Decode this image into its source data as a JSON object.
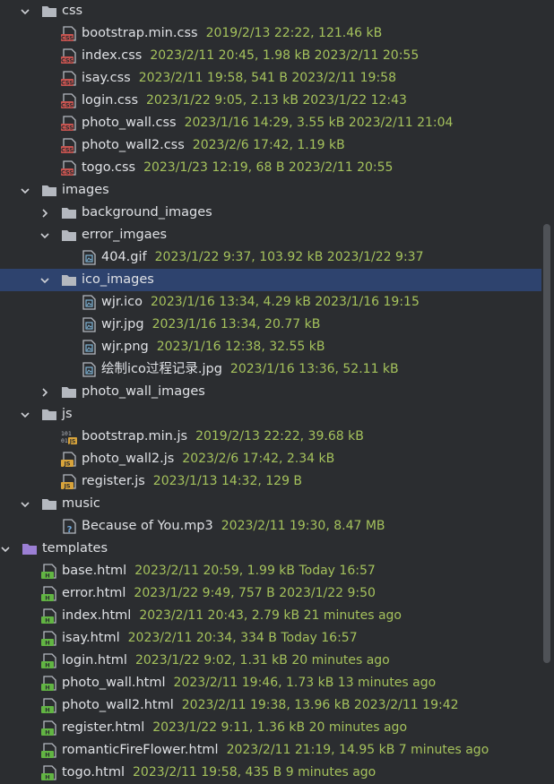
{
  "tree": [
    {
      "depth": 1,
      "kind": "folder",
      "expanded": true,
      "name": "css",
      "meta": ""
    },
    {
      "depth": 2,
      "kind": "css",
      "name": "bootstrap.min.css",
      "meta": "2019/2/13 22:22, 121.46 kB"
    },
    {
      "depth": 2,
      "kind": "css",
      "name": "index.css",
      "meta": "2023/2/11 20:45, 1.98 kB 2023/2/11 20:55"
    },
    {
      "depth": 2,
      "kind": "css",
      "name": "isay.css",
      "meta": "2023/2/11 19:58, 541 B 2023/2/11 19:58"
    },
    {
      "depth": 2,
      "kind": "css",
      "name": "login.css",
      "meta": "2023/1/22 9:05, 2.13 kB 2023/1/22 12:43"
    },
    {
      "depth": 2,
      "kind": "css",
      "name": "photo_wall.css",
      "meta": "2023/1/16 14:29, 3.55 kB 2023/2/11 21:04"
    },
    {
      "depth": 2,
      "kind": "css",
      "name": "photo_wall2.css",
      "meta": "2023/2/6 17:42, 1.19 kB"
    },
    {
      "depth": 2,
      "kind": "css",
      "name": "togo.css",
      "meta": "2023/1/23 12:19, 68 B 2023/2/11 20:55"
    },
    {
      "depth": 1,
      "kind": "folder",
      "expanded": true,
      "name": "images",
      "meta": ""
    },
    {
      "depth": 2,
      "kind": "folder",
      "expanded": false,
      "name": "background_images",
      "meta": ""
    },
    {
      "depth": 2,
      "kind": "folder",
      "expanded": true,
      "name": "error_imgaes",
      "meta": ""
    },
    {
      "depth": 3,
      "kind": "image",
      "name": "404.gif",
      "meta": "2023/1/22 9:37, 103.92 kB 2023/1/22 9:37"
    },
    {
      "depth": 2,
      "kind": "folder",
      "expanded": true,
      "name": "ico_images",
      "meta": "",
      "selected": true
    },
    {
      "depth": 3,
      "kind": "image",
      "name": "wjr.ico",
      "meta": "2023/1/16 13:34, 4.29 kB 2023/1/16 19:15"
    },
    {
      "depth": 3,
      "kind": "image",
      "name": "wjr.jpg",
      "meta": "2023/1/16 13:34, 20.77 kB"
    },
    {
      "depth": 3,
      "kind": "image",
      "name": "wjr.png",
      "meta": "2023/1/16 12:38, 32.55 kB"
    },
    {
      "depth": 3,
      "kind": "image",
      "name": "绘制ico过程记录.jpg",
      "meta": "2023/1/16 13:36, 52.11 kB"
    },
    {
      "depth": 2,
      "kind": "folder",
      "expanded": false,
      "name": "photo_wall_images",
      "meta": ""
    },
    {
      "depth": 1,
      "kind": "folder",
      "expanded": true,
      "name": "js",
      "meta": ""
    },
    {
      "depth": 2,
      "kind": "jsmin",
      "name": "bootstrap.min.js",
      "meta": "2019/2/13 22:22, 39.68 kB"
    },
    {
      "depth": 2,
      "kind": "js",
      "name": "photo_wall2.js",
      "meta": "2023/2/6 17:42, 2.34 kB"
    },
    {
      "depth": 2,
      "kind": "js",
      "name": "register.js",
      "meta": "2023/1/13 14:32, 129 B"
    },
    {
      "depth": 1,
      "kind": "folder",
      "expanded": true,
      "name": "music",
      "meta": ""
    },
    {
      "depth": 2,
      "kind": "unknown",
      "name": "Because of You.mp3",
      "meta": "2023/2/11 19:30, 8.47 MB"
    },
    {
      "depth": 0,
      "kind": "templates",
      "expanded": true,
      "name": "templates",
      "meta": ""
    },
    {
      "depth": 1,
      "kind": "html",
      "name": "base.html",
      "meta": "2023/2/11 20:59, 1.99 kB Today 16:57"
    },
    {
      "depth": 1,
      "kind": "html",
      "name": "error.html",
      "meta": "2023/1/22 9:49, 757 B 2023/1/22 9:50"
    },
    {
      "depth": 1,
      "kind": "html",
      "name": "index.html",
      "meta": "2023/2/11 20:43, 2.79 kB 21 minutes ago"
    },
    {
      "depth": 1,
      "kind": "html",
      "name": "isay.html",
      "meta": "2023/2/11 20:34, 334 B Today 16:57"
    },
    {
      "depth": 1,
      "kind": "html",
      "name": "login.html",
      "meta": "2023/1/22 9:02, 1.31 kB 20 minutes ago"
    },
    {
      "depth": 1,
      "kind": "html",
      "name": "photo_wall.html",
      "meta": "2023/2/11 19:46, 1.73 kB 13 minutes ago"
    },
    {
      "depth": 1,
      "kind": "html",
      "name": "photo_wall2.html",
      "meta": "2023/2/11 19:38, 13.96 kB 2023/2/11 19:42"
    },
    {
      "depth": 1,
      "kind": "html",
      "name": "register.html",
      "meta": "2023/1/22 9:11, 1.36 kB 20 minutes ago"
    },
    {
      "depth": 1,
      "kind": "html",
      "name": "romanticFireFlower.html",
      "meta": "2023/2/11 21:19, 14.95 kB 7 minutes ago"
    },
    {
      "depth": 1,
      "kind": "html",
      "name": "togo.html",
      "meta": "2023/2/11 19:58, 435 B 9 minutes ago"
    }
  ],
  "colors": {
    "background": "#2b2d30",
    "selection": "#2e436e",
    "text": "#dfe1e5",
    "meta": "#a5c25c",
    "folder": "#b4b8bf",
    "templates_folder": "#9b7fd4",
    "css_badge": "#c75450",
    "js_badge": "#d7a33b",
    "html_badge": "#62b543"
  }
}
